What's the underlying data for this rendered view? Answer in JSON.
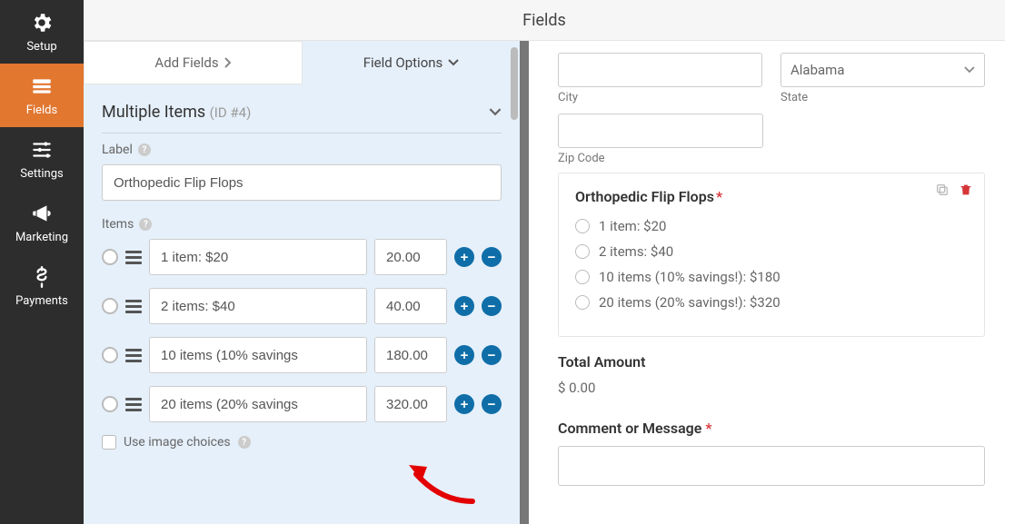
{
  "header": {
    "title": "Fields"
  },
  "nav": [
    {
      "icon": "gear",
      "label": "Setup"
    },
    {
      "icon": "fields",
      "label": "Fields"
    },
    {
      "icon": "sliders",
      "label": "Settings"
    },
    {
      "icon": "bullhorn",
      "label": "Marketing"
    },
    {
      "icon": "dollar",
      "label": "Payments"
    }
  ],
  "tabs": {
    "add": "Add Fields",
    "options": "Field Options"
  },
  "panel": {
    "title": "Multiple Items",
    "id": "(ID #4)",
    "label_caption": "Label",
    "label_value": "Orthopedic Flip Flops",
    "items_caption": "Items",
    "use_image": "Use image choices",
    "items": [
      {
        "label": "1 item: $20",
        "price": "20.00"
      },
      {
        "label": "2 items: $40",
        "price": "40.00"
      },
      {
        "label": "10 items (10% savings",
        "price": "180.00"
      },
      {
        "label": "20 items (20% savings",
        "price": "320.00"
      }
    ]
  },
  "preview": {
    "state_value": "Alabama",
    "city_label": "City",
    "state_label": "State",
    "zip_label": "Zip Code",
    "card_title": "Orthopedic Flip Flops",
    "options": [
      "1 item: $20",
      "2 items: $40",
      "10 items (10% savings!): $180",
      "20 items (20% savings!): $320"
    ],
    "total_label": "Total Amount",
    "total_value": "$ 0.00",
    "msg_label": "Comment or Message"
  }
}
